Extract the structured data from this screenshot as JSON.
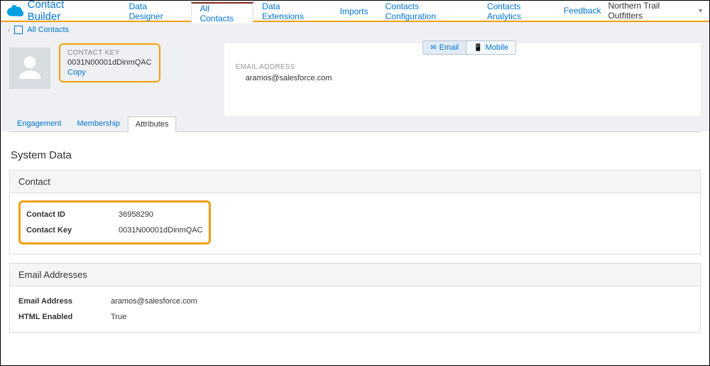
{
  "header": {
    "app_title": "Contact Builder",
    "nav_tabs": [
      {
        "label": "Data Designer"
      },
      {
        "label": "All Contacts",
        "active": true
      },
      {
        "label": "Data Extensions"
      },
      {
        "label": "Imports"
      },
      {
        "label": "Contacts Configuration"
      },
      {
        "label": "Contacts Analytics"
      }
    ],
    "feedback_label": "Feedback",
    "account_label": "Northern Trail Outfitters"
  },
  "breadcrumb": {
    "label": "All Contacts"
  },
  "contact": {
    "key_label": "CONTACT KEY",
    "key_value": "0031N00001dDinmQAC",
    "copy_label": "Copy",
    "email_label": "EMAIL ADDRESS",
    "email_value": "aramos@salesforce.com",
    "channels": {
      "email": "Email",
      "mobile": "Mobile"
    }
  },
  "subtabs": [
    {
      "label": "Engagement"
    },
    {
      "label": "Membership"
    },
    {
      "label": "Attributes",
      "active": true
    }
  ],
  "system_data": {
    "title": "System Data",
    "contact_section": {
      "title": "Contact",
      "rows": {
        "id_label": "Contact ID",
        "id_value": "36958290",
        "key_label": "Contact Key",
        "key_value": "0031N00001dDinmQAC"
      }
    },
    "email_section": {
      "title": "Email Addresses",
      "rows": {
        "addr_label": "Email Address",
        "addr_value": "aramos@salesforce.com",
        "html_label": "HTML Enabled",
        "html_value": "True"
      }
    }
  }
}
